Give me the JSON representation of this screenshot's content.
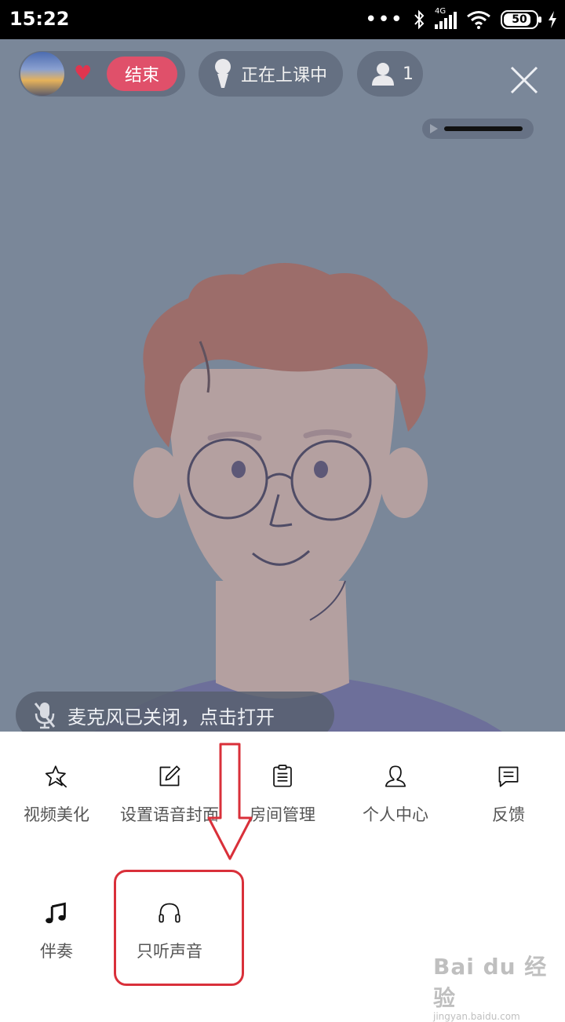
{
  "status_bar": {
    "time": "15:22",
    "network": "4G",
    "battery": "50"
  },
  "room": {
    "end_label": "结束",
    "status_label": "正在上课中",
    "audience_count": "1"
  },
  "mic_notice": "麦克风已关闭，点击打开",
  "menu": {
    "items": [
      {
        "label": "视频美化",
        "icon": "magic-wand-icon"
      },
      {
        "label": "设置语音封面",
        "icon": "edit-icon"
      },
      {
        "label": "房间管理",
        "icon": "clipboard-icon"
      },
      {
        "label": "个人中心",
        "icon": "user-icon"
      },
      {
        "label": "反馈",
        "icon": "feedback-icon"
      },
      {
        "label": "伴奏",
        "icon": "music-note-icon"
      },
      {
        "label": "只听声音",
        "icon": "headphones-icon"
      }
    ]
  },
  "watermark": {
    "brand": "Bai du 经验",
    "site": "jingyan.baidu.com"
  },
  "colors": {
    "stage_bg": "#7a8799",
    "accent_red": "#e0506a",
    "annotation_red": "#d9303a"
  }
}
